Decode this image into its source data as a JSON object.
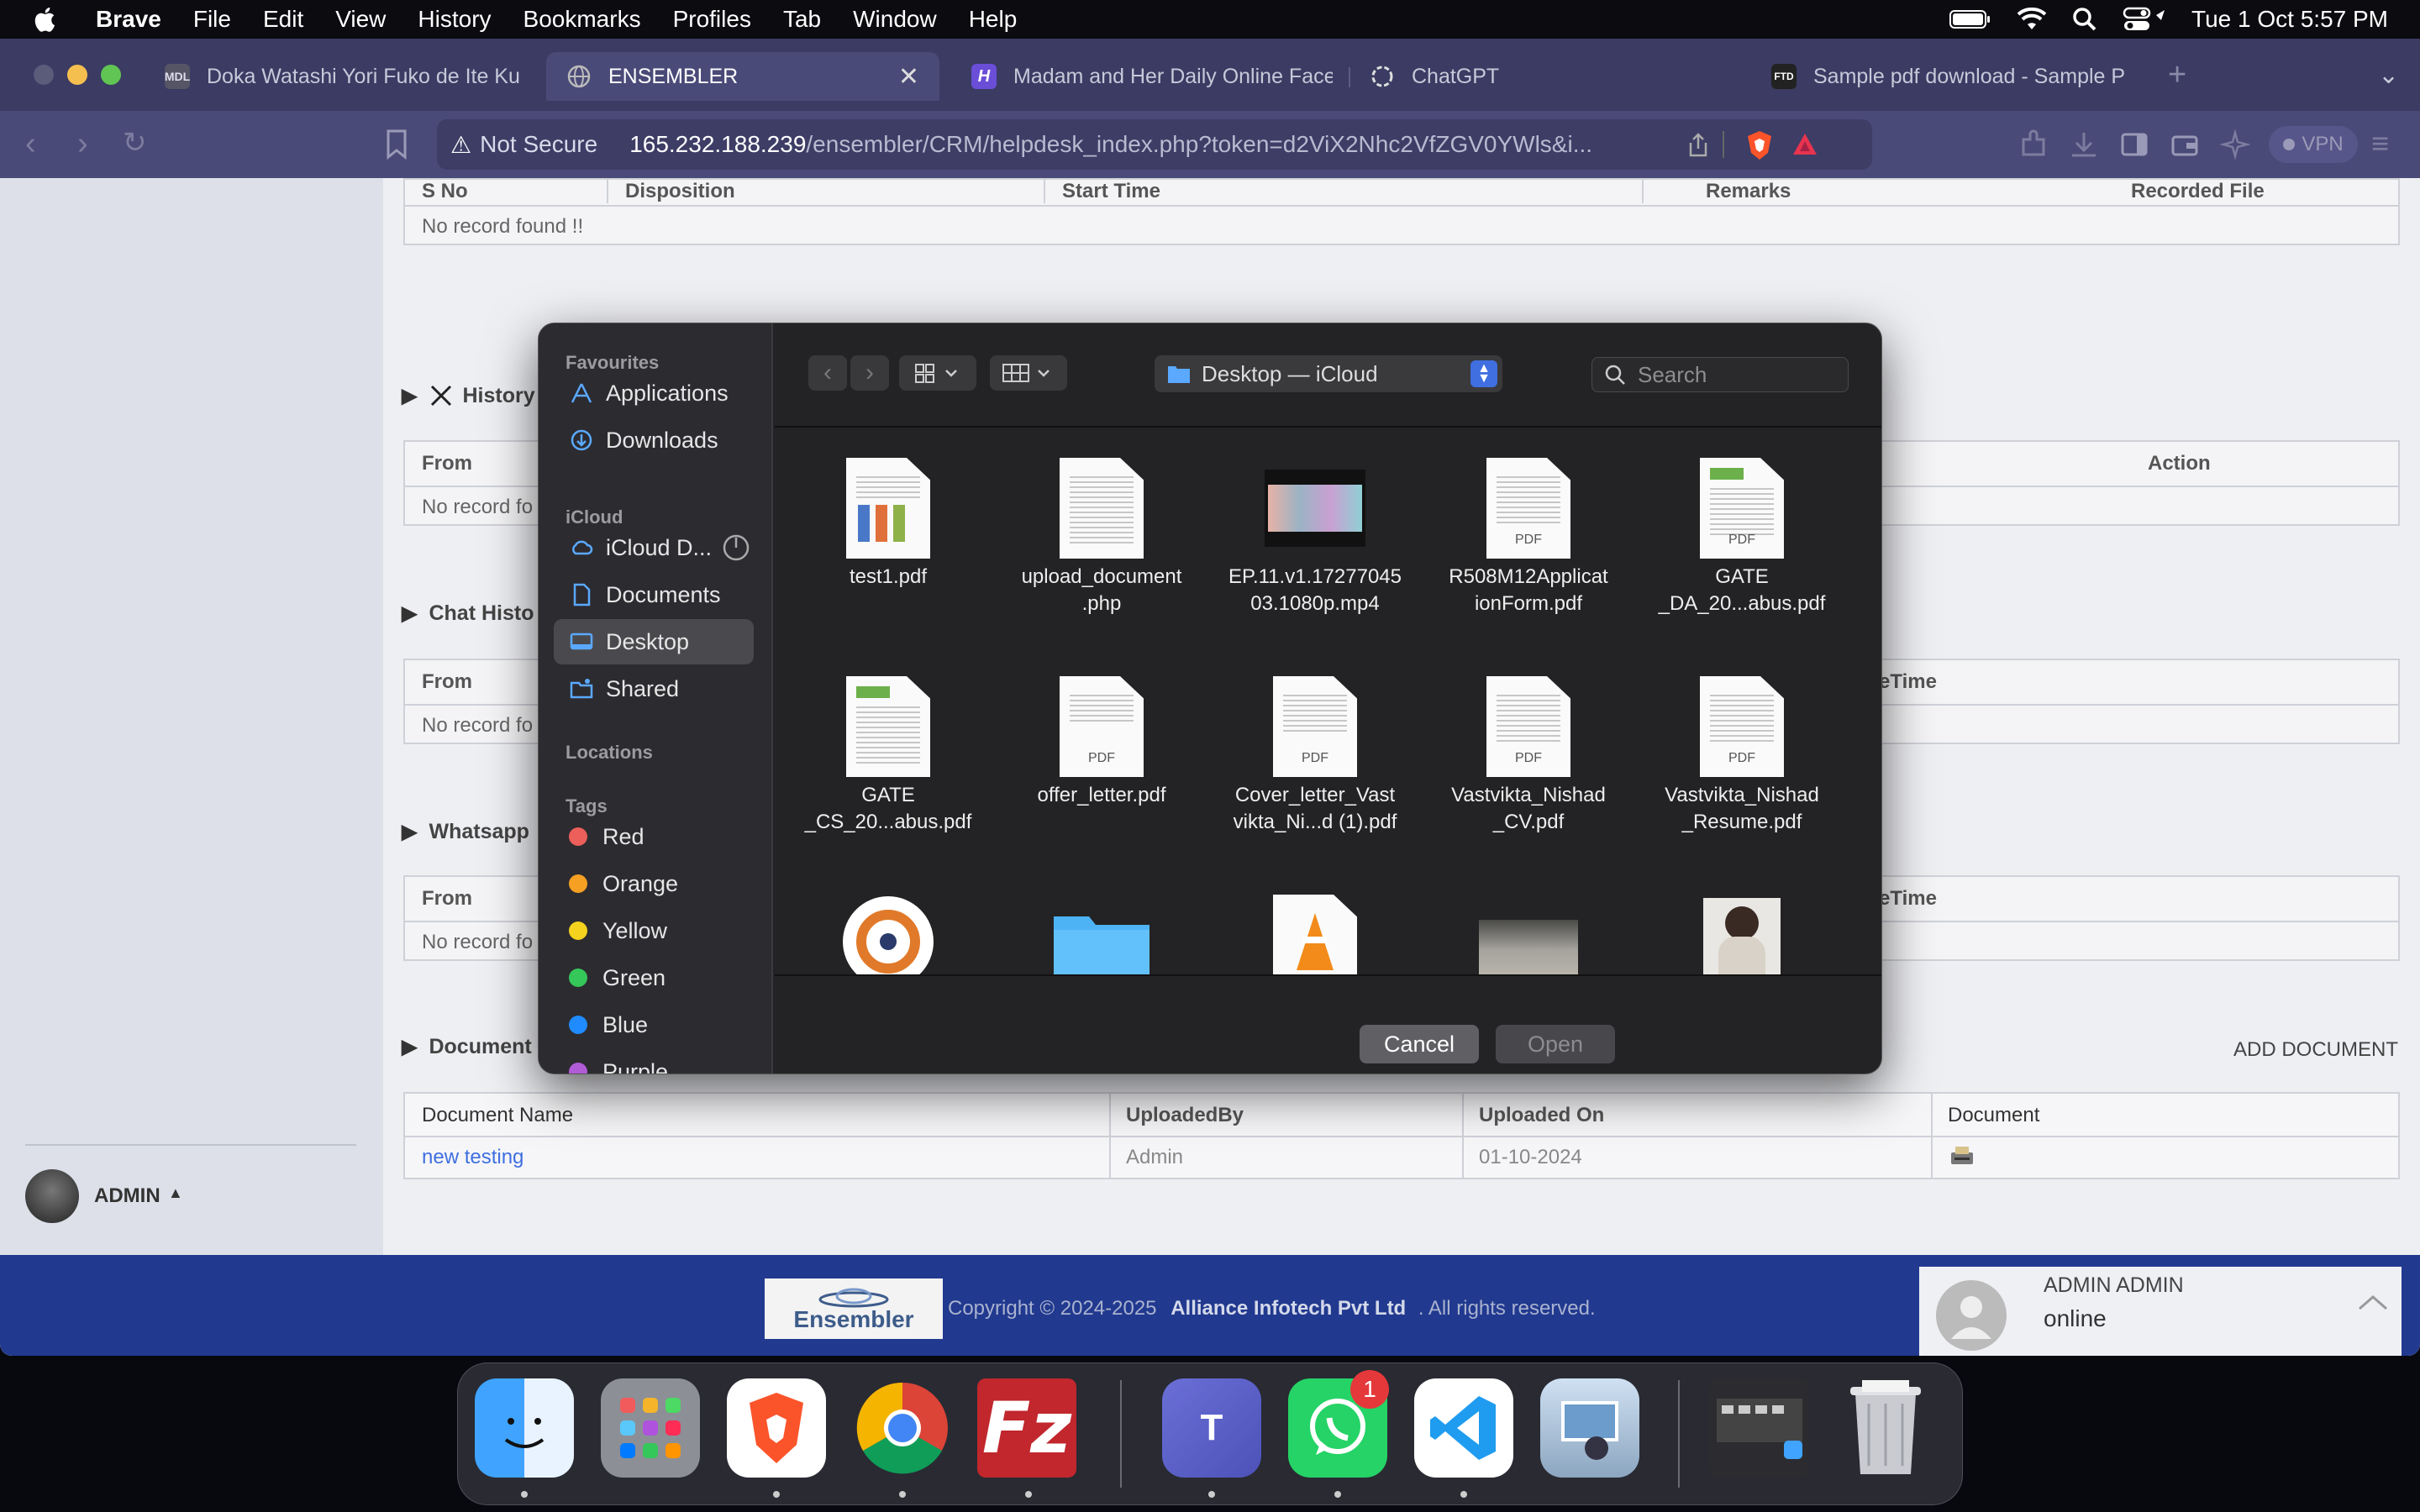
{
  "menubar": {
    "app": "Brave",
    "items": [
      "File",
      "Edit",
      "View",
      "History",
      "Bookmarks",
      "Profiles",
      "Tab",
      "Window",
      "Help"
    ],
    "datetime": "Tue 1 Oct  5:57 PM"
  },
  "tabs": [
    {
      "title": "Doka Watashi Yori Fuko de Ite Ku",
      "fav": "MDL"
    },
    {
      "title": "ENSEMBLER",
      "fav": ""
    },
    {
      "title": "Madam and Her Daily Online Face",
      "fav": "H"
    },
    {
      "title": "ChatGPT",
      "fav": ""
    },
    {
      "title": "Sample pdf download - Sample P",
      "fav": "FTD"
    }
  ],
  "urlbar": {
    "security": "Not Secure",
    "url_host": "165.232.188.239",
    "url_path": "/ensembler/CRM/helpdesk_index.php?token=d2ViX2Nhc2VfZGV0YWls&i...",
    "vpn": "VPN"
  },
  "page": {
    "calls_table": {
      "headers": [
        "S No",
        "Disposition",
        "Start Time",
        "Remarks",
        "Recorded File"
      ],
      "empty": "No record found !!"
    },
    "history": {
      "title": "History",
      "headers": [
        "From",
        "Action"
      ],
      "empty": "No record fo"
    },
    "chat_history": {
      "title": "Chat Histo",
      "headers": [
        "From",
        "eTime"
      ],
      "empty": "No record fo"
    },
    "whatsapp": {
      "title": "Whatsapp",
      "headers": [
        "From",
        "eTime"
      ],
      "empty": "No record fo"
    },
    "documents": {
      "title": "Document",
      "add_label": "ADD DOCUMENT",
      "headers": [
        "Document Name",
        "UploadedBy",
        "Uploaded On",
        "Document"
      ],
      "rows": [
        [
          "new testing",
          "Admin",
          "01-10-2024"
        ]
      ]
    },
    "user": "ADMIN",
    "footer": {
      "copyright": "Copyright © 2024-2025",
      "company": "Alliance Infotech Pvt Ltd",
      "rights": ". All rights reserved.",
      "logo": "Ensembler"
    },
    "chat_widget": {
      "name": "ADMIN ADMIN",
      "status": "online"
    }
  },
  "dialog": {
    "favourites_label": "Favourites",
    "favourites": [
      "Applications",
      "Downloads"
    ],
    "icloud_label": "iCloud",
    "icloud": [
      "iCloud D...",
      "Documents",
      "Desktop",
      "Shared"
    ],
    "locations_label": "Locations",
    "tags_label": "Tags",
    "tags": [
      {
        "name": "Red",
        "color": "#ec5f5a"
      },
      {
        "name": "Orange",
        "color": "#f5a023"
      },
      {
        "name": "Yellow",
        "color": "#f4d21e"
      },
      {
        "name": "Green",
        "color": "#35c759"
      },
      {
        "name": "Blue",
        "color": "#1f8bff"
      },
      {
        "name": "Purple",
        "color": "#b05cd6"
      }
    ],
    "location": "Desktop — iCloud",
    "search_placeholder": "Search",
    "files": [
      {
        "name": "test1.pdf",
        "kind": "doc"
      },
      {
        "name": "upload_document\n.php",
        "kind": "doc"
      },
      {
        "name": "EP.11.v1.17277045\n03.1080p.mp4",
        "kind": "video"
      },
      {
        "name": "R508M12Applicat\nionForm.pdf",
        "kind": "pdf"
      },
      {
        "name": "GATE\n_DA_20...abus.pdf",
        "kind": "pdf"
      },
      {
        "name": "GATE\n_CS_20...abus.pdf",
        "kind": "doc"
      },
      {
        "name": "offer_letter.pdf",
        "kind": "pdf"
      },
      {
        "name": "Cover_letter_Vast\nvikta_Ni...d (1).pdf",
        "kind": "pdf"
      },
      {
        "name": "Vastvikta_Nishad\n_CV.pdf",
        "kind": "pdf"
      },
      {
        "name": "Vastvikta_Nishad\n_Resume.pdf",
        "kind": "pdf"
      },
      {
        "name": "",
        "kind": "app"
      },
      {
        "name": "",
        "kind": "folder"
      },
      {
        "name": "",
        "kind": "vlc"
      },
      {
        "name": "",
        "kind": "photo"
      },
      {
        "name": "",
        "kind": "portrait"
      }
    ],
    "cancel": "Cancel",
    "open": "Open"
  },
  "dock": {
    "apps": [
      "Finder",
      "Launchpad",
      "Brave",
      "Chrome",
      "FileZilla",
      "Teams",
      "WhatsApp",
      "VS Code",
      "Preview",
      "Screenshot",
      "Trash"
    ],
    "whatsapp_badge": "1"
  },
  "colors": {
    "accent": "#3f6fe0",
    "footer": "#21398f",
    "tab_bar": "#3b3b63"
  }
}
